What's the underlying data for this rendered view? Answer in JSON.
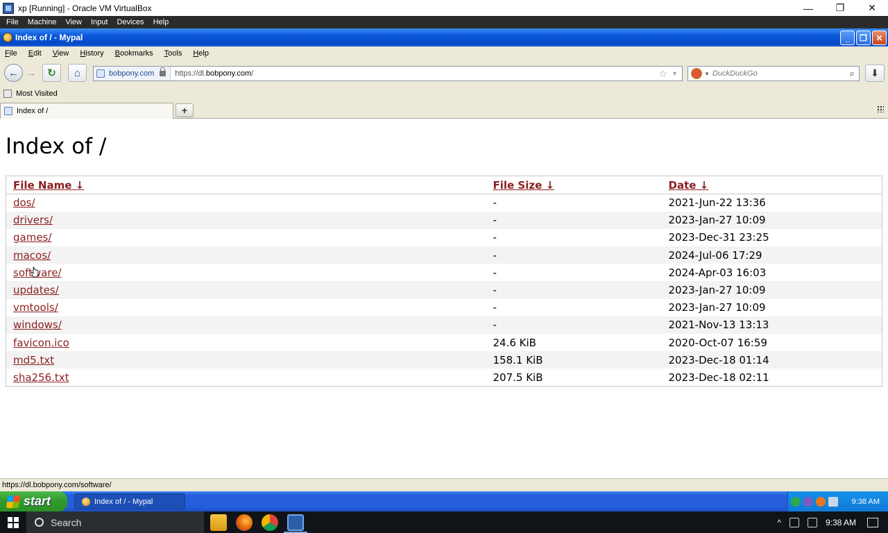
{
  "host_window": {
    "title": "xp [Running] - Oracle VM VirtualBox",
    "controls": [
      "—",
      "❐",
      "✕"
    ],
    "menu": [
      "File",
      "Machine",
      "View",
      "Input",
      "Devices",
      "Help"
    ]
  },
  "browser": {
    "window_title": "Index of / - Mypal",
    "menu": [
      "File",
      "Edit",
      "View",
      "History",
      "Bookmarks",
      "Tools",
      "Help"
    ],
    "identity_label": "bobpony.com",
    "url_prefix": "https://dl.",
    "url_domain": "bobpony.com",
    "url_suffix": "/",
    "search_placeholder": "DuckDuckGo",
    "bookmarks_toolbar": [
      "Most Visited"
    ],
    "tab_label": "Index of /",
    "status_text": "https://dl.bobpony.com/software/"
  },
  "page": {
    "heading": "Index of /",
    "columns": [
      "File Name  ↓",
      "File Size  ↓",
      "Date  ↓"
    ],
    "rows": [
      {
        "name": "dos/",
        "size": "-",
        "date": "2021-Jun-22 13:36"
      },
      {
        "name": "drivers/",
        "size": "-",
        "date": "2023-Jan-27 10:09"
      },
      {
        "name": "games/",
        "size": "-",
        "date": "2023-Dec-31 23:25"
      },
      {
        "name": "macos/",
        "size": "-",
        "date": "2024-Jul-06 17:29"
      },
      {
        "name": "software/",
        "size": "-",
        "date": "2024-Apr-03 16:03"
      },
      {
        "name": "updates/",
        "size": "-",
        "date": "2023-Jan-27 10:09"
      },
      {
        "name": "vmtools/",
        "size": "-",
        "date": "2023-Jan-27 10:09"
      },
      {
        "name": "windows/",
        "size": "-",
        "date": "2021-Nov-13 13:13"
      },
      {
        "name": "favicon.ico",
        "size": "24.6 KiB",
        "date": "2020-Oct-07 16:59"
      },
      {
        "name": "md5.txt",
        "size": "158.1 KiB",
        "date": "2023-Dec-18 01:14"
      },
      {
        "name": "sha256.txt",
        "size": "207.5 KiB",
        "date": "2023-Dec-18 02:11"
      }
    ]
  },
  "xp_taskbar": {
    "start_label": "start",
    "task_item": "Index of / - Mypal",
    "clock": "9:38 AM"
  },
  "win_taskbar": {
    "search_label": "Search",
    "clock": "9:38 AM"
  },
  "colors": {
    "link": "#8b1f1f",
    "xp_title_blue": "#0a58d8",
    "xp_start_green": "#2f9a2a"
  }
}
